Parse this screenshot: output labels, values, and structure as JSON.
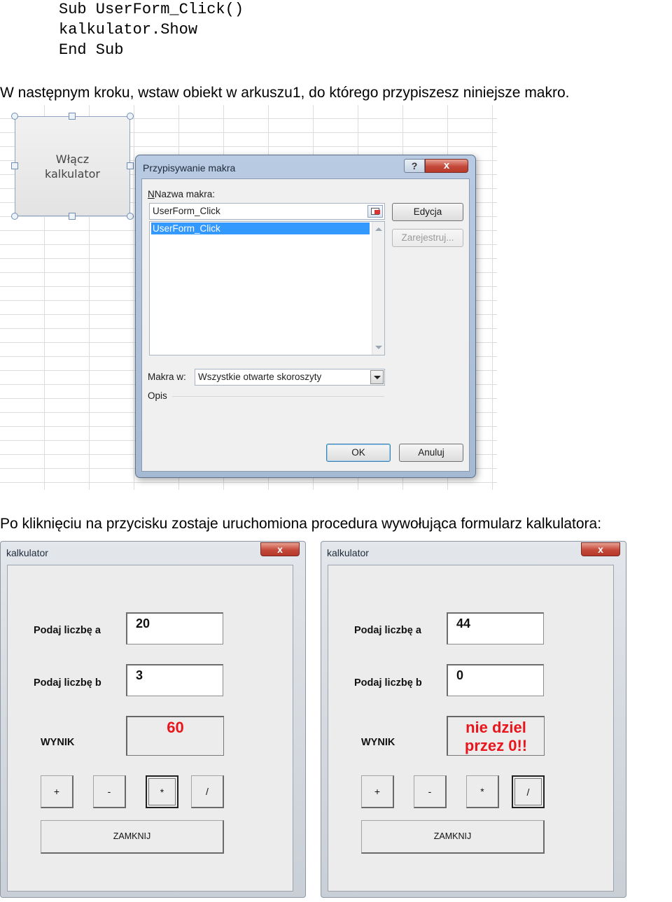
{
  "code": {
    "line1": "Sub UserForm_Click()",
    "line2": "kalkulator.Show",
    "line3": "End Sub"
  },
  "paragraph1": "W następnym kroku, wstaw obiekt w arkuszu1, do którego przypiszesz niniejsze makro.",
  "shape_button": {
    "line1": "Włącz",
    "line2": "kalkulator"
  },
  "macro_dialog": {
    "title": "Przypisywanie makra",
    "help_label": "?",
    "close_label": "x",
    "name_label": "Nazwa makra:",
    "name_value": "UserForm_Click",
    "list_items": [
      "UserForm_Click"
    ],
    "edit_button": "Edycja",
    "record_button": "Zarejestruj...",
    "macros_in_label": "Makra w:",
    "macros_in_value": "Wszystkie otwarte skoroszyty",
    "description_label": "Opis",
    "ok_button": "OK",
    "cancel_button": "Anuluj"
  },
  "paragraph2": "Po kliknięciu na przycisku zostaje uruchomiona procedura wywołująca formularz kalkulatora:",
  "calculators": [
    {
      "title": "kalkulator",
      "close_label": "x",
      "label_a": "Podaj liczbę a",
      "value_a": "20",
      "label_b": "Podaj liczbę b",
      "value_b": "3",
      "result_label": "WYNIK",
      "result_line1": "60",
      "result_line2": "",
      "op_plus": "+",
      "op_minus": "-",
      "op_mul": "*",
      "op_div": "/",
      "pressed_op": "*",
      "close_button": "ZAMKNIJ"
    },
    {
      "title": "kalkulator",
      "close_label": "x",
      "label_a": "Podaj liczbę a",
      "value_a": "44",
      "label_b": "Podaj liczbę b",
      "value_b": "0",
      "result_label": "WYNIK",
      "result_line1": "nie dziel",
      "result_line2": "przez 0!!",
      "op_plus": "+",
      "op_minus": "-",
      "op_mul": "*",
      "op_div": "/",
      "pressed_op": "/",
      "close_button": "ZAMKNIJ"
    }
  ],
  "colors": {
    "result_text": "#e8161c",
    "list_selection": "#3399ff",
    "close_button": "#c4493a"
  }
}
